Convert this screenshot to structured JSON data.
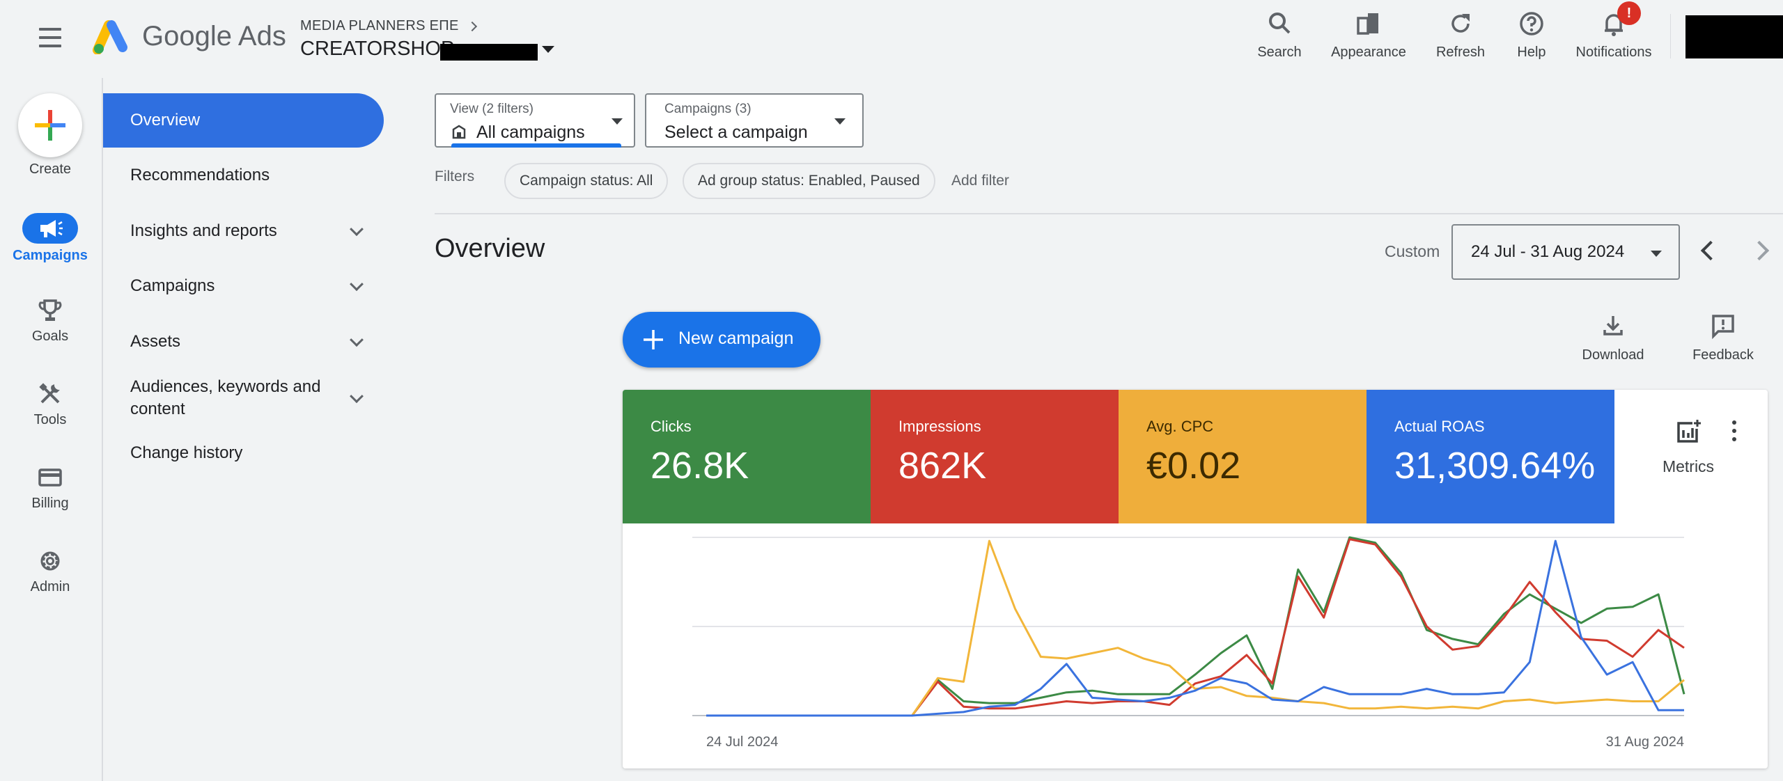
{
  "header": {
    "logo_text": "Google Ads",
    "account_path": "MEDIA PLANNERS ΕΠΕ",
    "account_name": "CREATORSHOP",
    "tools": [
      {
        "label": "Search",
        "icon": "search-icon"
      },
      {
        "label": "Appearance",
        "icon": "appearance-icon"
      },
      {
        "label": "Refresh",
        "icon": "refresh-icon"
      },
      {
        "label": "Help",
        "icon": "help-icon"
      },
      {
        "label": "Notifications",
        "icon": "bell-icon"
      }
    ],
    "notification_badge": "!"
  },
  "rail": {
    "create_label": "Create",
    "items": [
      {
        "label": "Campaigns",
        "icon": "megaphone-icon",
        "active": true
      },
      {
        "label": "Goals",
        "icon": "trophy-icon"
      },
      {
        "label": "Tools",
        "icon": "tools-icon"
      },
      {
        "label": "Billing",
        "icon": "credit-card-icon"
      },
      {
        "label": "Admin",
        "icon": "gear-icon"
      }
    ]
  },
  "sidenav": {
    "items": [
      {
        "label": "Overview",
        "active": true
      },
      {
        "label": "Recommendations"
      },
      {
        "label": "Insights and reports",
        "expandable": true
      },
      {
        "label": "Campaigns",
        "expandable": true
      },
      {
        "label": "Assets",
        "expandable": true
      },
      {
        "label": "Audiences, keywords and content",
        "expandable": true
      },
      {
        "label": "Change history"
      }
    ]
  },
  "filters": {
    "view": {
      "label": "View (2 filters)",
      "value": "All campaigns"
    },
    "campaigns": {
      "label": "Campaigns (3)",
      "value": "Select a campaign"
    },
    "filters_label": "Filters",
    "chips": [
      "Campaign status: All",
      "Ad group status: Enabled, Paused"
    ],
    "add_filter": "Add filter"
  },
  "overview": {
    "title": "Overview",
    "date_mode": "Custom",
    "date_range": "24 Jul - 31 Aug 2024",
    "new_campaign": "New campaign",
    "download": "Download",
    "feedback": "Feedback",
    "metrics_label": "Metrics"
  },
  "metrics": [
    {
      "label": "Clicks",
      "value": "26.8K",
      "color": "#3c8a45"
    },
    {
      "label": "Impressions",
      "value": "862K",
      "color": "#d03b2f"
    },
    {
      "label": "Avg. CPC",
      "value": "€0.02",
      "color": "#efae3b"
    },
    {
      "label": "Actual ROAS",
      "value": "31,309.64%",
      "color": "#2f6fe0"
    }
  ],
  "chart_data": {
    "type": "line",
    "x_start": "24 Jul 2024",
    "x_end": "31 Aug 2024",
    "y_range": [
      0,
      100
    ],
    "grid": true,
    "series": [
      {
        "color": "#3c8a45",
        "values": [
          0,
          0,
          0,
          0,
          0,
          0,
          0,
          0,
          0,
          20,
          8,
          7,
          7,
          10,
          13,
          14,
          12,
          12,
          12,
          23,
          35,
          45,
          15,
          82,
          58,
          100,
          97,
          80,
          48,
          43,
          40,
          57,
          68,
          60,
          52,
          60,
          61,
          68,
          12
        ]
      },
      {
        "color": "#d03b2f",
        "values": [
          0,
          0,
          0,
          0,
          0,
          0,
          0,
          0,
          0,
          19,
          5,
          4,
          4,
          6,
          8,
          7,
          8,
          8,
          6,
          18,
          22,
          34,
          18,
          78,
          55,
          99,
          96,
          78,
          50,
          37,
          39,
          55,
          75,
          58,
          43,
          42,
          33,
          48,
          38
        ]
      },
      {
        "color": "#f2b63a",
        "values": [
          0,
          0,
          0,
          0,
          0,
          0,
          0,
          0,
          0,
          21,
          19,
          98,
          60,
          33,
          32,
          35,
          38,
          32,
          28,
          15,
          16,
          11,
          10,
          8,
          7,
          4,
          4,
          5,
          4,
          5,
          4,
          8,
          9,
          7,
          8,
          9,
          8,
          8,
          20
        ]
      },
      {
        "color": "#3a72df",
        "values": [
          0,
          0,
          0,
          0,
          0,
          0,
          0,
          0,
          0,
          1,
          2,
          5,
          6,
          15,
          29,
          10,
          9,
          8,
          10,
          14,
          21,
          18,
          9,
          8,
          16,
          12,
          12,
          12,
          15,
          12,
          12,
          13,
          30,
          98,
          44,
          23,
          30,
          3,
          3
        ]
      }
    ]
  }
}
